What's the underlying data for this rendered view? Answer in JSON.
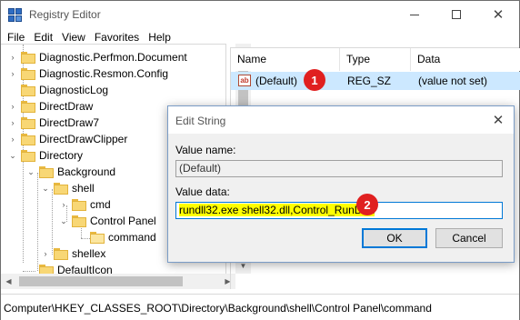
{
  "window": {
    "title": "Registry Editor",
    "icon": "registry-cubes-icon"
  },
  "menu": [
    "File",
    "Edit",
    "View",
    "Favorites",
    "Help"
  ],
  "tree": {
    "items": [
      {
        "label": "Diagnostic.Perfmon.Document",
        "expander": "›"
      },
      {
        "label": "Diagnostic.Resmon.Config",
        "expander": "›"
      },
      {
        "label": "DiagnosticLog",
        "expander": ""
      },
      {
        "label": "DirectDraw",
        "expander": "›"
      },
      {
        "label": "DirectDraw7",
        "expander": "›"
      },
      {
        "label": "DirectDrawClipper",
        "expander": "›"
      },
      {
        "label": "Directory",
        "expander": "⌄"
      },
      {
        "label": "Background",
        "expander": "⌄"
      },
      {
        "label": "shell",
        "expander": "⌄"
      },
      {
        "label": "cmd",
        "expander": "›"
      },
      {
        "label": "Control Panel",
        "expander": "⌄"
      },
      {
        "label": "command",
        "expander": ""
      },
      {
        "label": "shellex",
        "expander": "›"
      },
      {
        "label": "DefaultIcon",
        "expander": ""
      }
    ]
  },
  "list": {
    "columns": [
      "Name",
      "Type",
      "Data"
    ],
    "rows": [
      {
        "name": "(Default)",
        "type": "REG_SZ",
        "data": "(value not set)",
        "icon": "string-value-icon"
      }
    ]
  },
  "markers": [
    "1",
    "2"
  ],
  "status": {
    "path": "Computer\\HKEY_CLASSES_ROOT\\Directory\\Background\\shell\\Control Panel\\command"
  },
  "dialog": {
    "title": "Edit String",
    "value_name_label": "Value name:",
    "value_name": "(Default)",
    "value_data_label": "Value data:",
    "value_data": "rundll32.exe shell32.dll,Control_RunDLL",
    "ok_label": "OK",
    "cancel_label": "Cancel",
    "highlight_color": "#ffff00"
  },
  "colors": {
    "selection": "#cce8ff",
    "marker": "#e02020",
    "accent": "#0078d7"
  }
}
